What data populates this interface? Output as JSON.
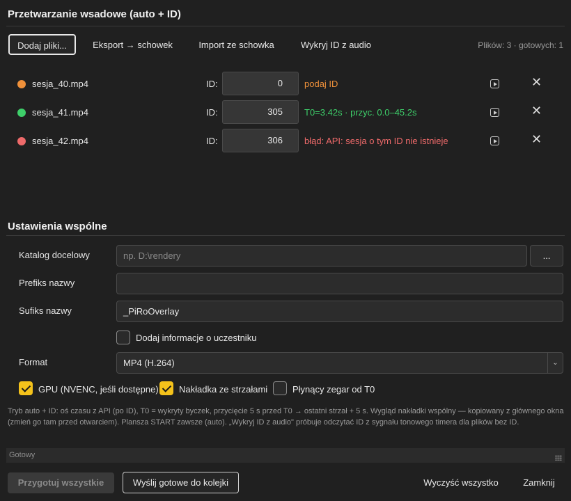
{
  "header": {
    "title": "Przetwarzanie wsadowe (auto + ID)"
  },
  "toolbar": {
    "add_files": "Dodaj pliki...",
    "export": "Eksport → schowek",
    "import": "Import ze schowka",
    "detect": "Wykryj ID z audio",
    "count": "Plików: 3 · gotowych: 1"
  },
  "files": [
    {
      "name": "sesja_40.mp4",
      "id_label": "ID:",
      "id": "0",
      "status": "podaj ID",
      "dot_color": "#f0913a",
      "status_color": "#f0913a"
    },
    {
      "name": "sesja_41.mp4",
      "id_label": "ID:",
      "id": "305",
      "status": "T0=3.42s · przyc. 0.0–45.2s",
      "dot_color": "#3ecf6a",
      "status_color": "#3ecf6a"
    },
    {
      "name": "sesja_42.mp4",
      "id_label": "ID:",
      "id": "306",
      "status": "błąd: API: sesja o tym ID nie istnieje",
      "dot_color": "#ee6a6a",
      "status_color": "#ee6a6a"
    }
  ],
  "settings": {
    "title": "Ustawienia wspólne",
    "target_dir_label": "Katalog docelowy",
    "target_dir_placeholder": "np. D:\\rendery",
    "browse_label": "...",
    "prefix_label": "Prefiks nazwy",
    "prefix_value": "",
    "suffix_label": "Sufiks nazwy",
    "suffix_value": "_PiRoOverlay",
    "participant_info_label": "Dodaj informacje o uczestniku",
    "participant_info_checked": false,
    "format_label": "Format",
    "format_value": "MP4 (H.264)",
    "gpu_label": "GPU (NVENC, jeśli dostępne)",
    "gpu_checked": true,
    "overlay_label": "Nakładka ze strzałami",
    "overlay_checked": true,
    "clock_label": "Płynący zegar od T0",
    "clock_checked": false
  },
  "help_text": "Tryb auto + ID: oś czasu z API (po ID), T0 = wykryty byczek, przycięcie 5 s przed T0 → ostatni strzał + 5 s. Wygląd nakładki wspólny — kopiowany z głównego okna (zmień go tam przed otwarciem). Plansza START zawsze (auto). „Wykryj ID z audio\" próbuje odczytać ID z sygnału tonowego timera dla plików bez ID.",
  "status_bar": "Gotowy",
  "footer": {
    "prepare_all": "Przygotuj wszystkie",
    "send_ready": "Wyślij gotowe do kolejki",
    "clear_all": "Wyczyść wszystko",
    "close": "Zamknij"
  },
  "colors": {
    "accent": "#f4c21b",
    "background": "#202020"
  }
}
